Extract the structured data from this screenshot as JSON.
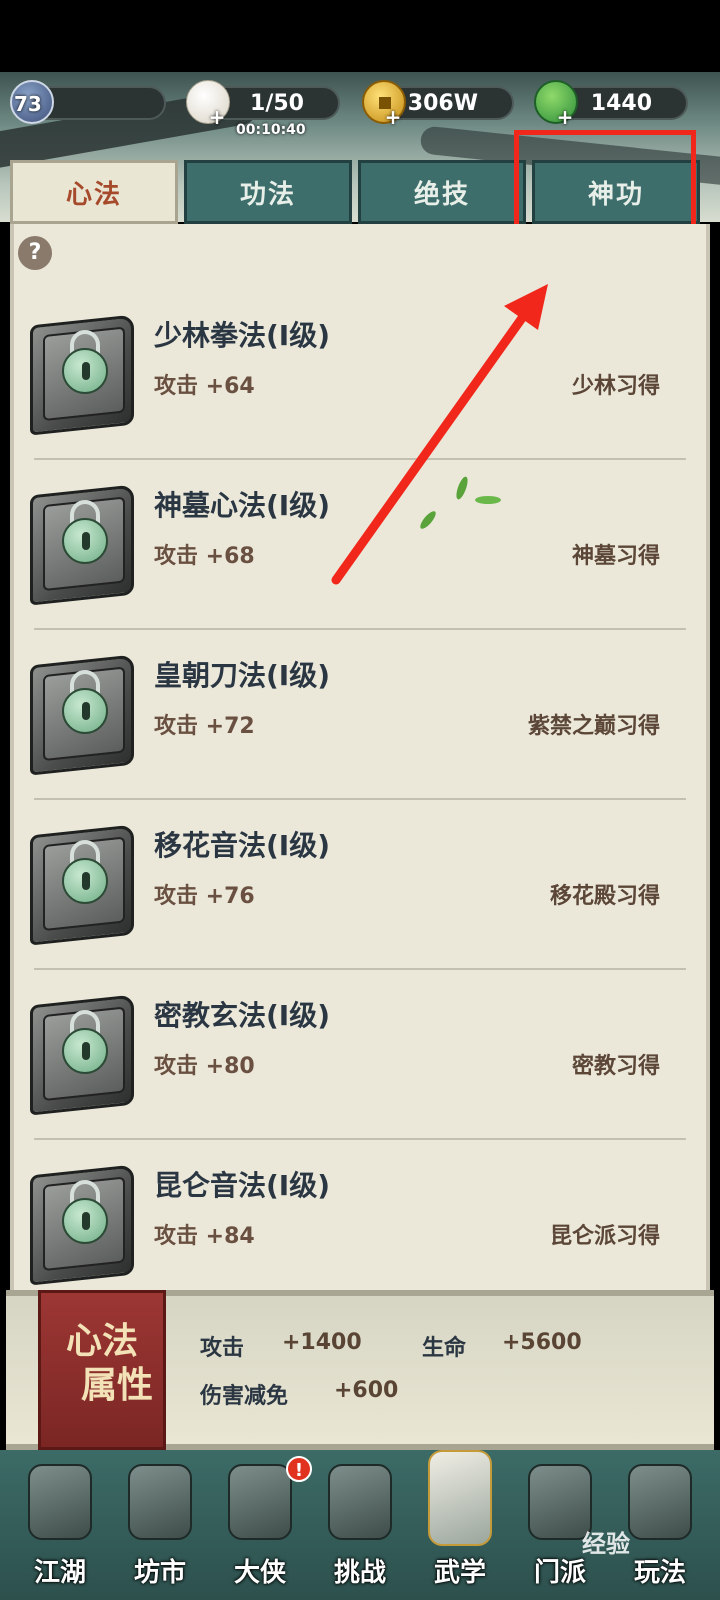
{
  "resources": {
    "level": "73",
    "stamina": "1/50",
    "timer": "00:10:40",
    "coins": "306W",
    "leaves": "1440"
  },
  "tabs": [
    "心法",
    "功法",
    "绝技",
    "神功"
  ],
  "active_tab": "心法",
  "items": [
    {
      "name": "少林拳法(I级)",
      "stat": "攻击 +64",
      "source": "少林习得"
    },
    {
      "name": "神墓心法(I级)",
      "stat": "攻击 +68",
      "source": "神墓习得"
    },
    {
      "name": "皇朝刀法(I级)",
      "stat": "攻击 +72",
      "source": "紫禁之巅习得"
    },
    {
      "name": "移花音法(I级)",
      "stat": "攻击 +76",
      "source": "移花殿习得"
    },
    {
      "name": "密教玄法(I级)",
      "stat": "攻击 +80",
      "source": "密教习得"
    },
    {
      "name": "昆仑音法(I级)",
      "stat": "攻击 +84",
      "source": "昆仑派习得"
    }
  ],
  "attributes": {
    "banner_line1": "心法",
    "banner_line2": "属性",
    "attack_label": "攻击",
    "attack_value": "+1400",
    "life_label": "生命",
    "life_value": "+5600",
    "reduction_label": "伤害减免",
    "reduction_value": "+600"
  },
  "nav": [
    "江湖",
    "坊市",
    "大侠",
    "挑战",
    "武学",
    "门派",
    "玩法"
  ],
  "active_nav": "武学",
  "nav_badge": "!",
  "watermark": "经验",
  "colors": {
    "highlight": "#f0271a",
    "tab_inactive": "#3e6e6c",
    "tab_active": "#eae6d4",
    "panel_bg": "#ebe8da"
  }
}
